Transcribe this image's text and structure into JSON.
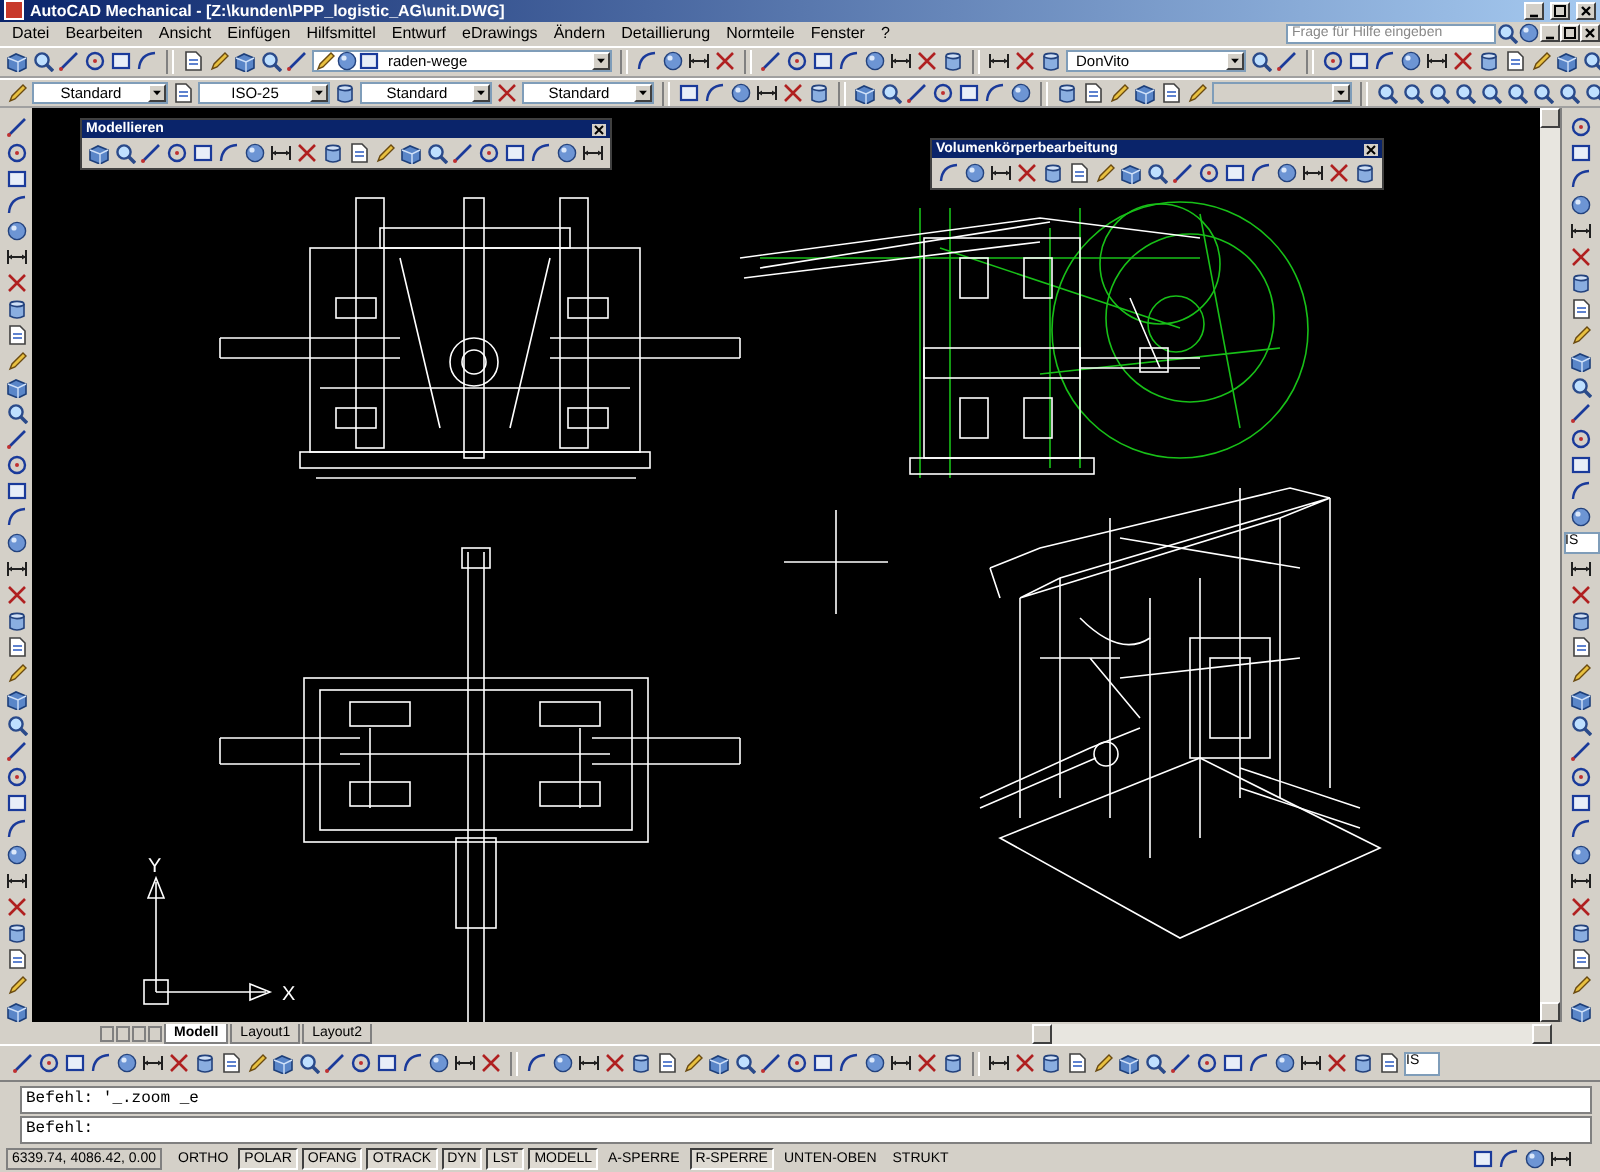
{
  "window": {
    "title": "AutoCAD Mechanical - [Z:\\kunden\\PPP_logistic_AG\\unit.DWG]"
  },
  "menu": [
    "Datei",
    "Bearbeiten",
    "Ansicht",
    "Einfügen",
    "Hilfsmittel",
    "Entwurf",
    "eDrawings",
    "Ändern",
    "Detaillierung",
    "Normteile",
    "Fenster",
    "?"
  ],
  "help_search": {
    "placeholder": "Frage für Hilfe eingeben"
  },
  "toolbar": {
    "layer": "raden-wege",
    "profile": "DonVito"
  },
  "style_boxes": [
    "Standard",
    "ISO-25",
    "Standard",
    "Standard"
  ],
  "palettes": [
    {
      "title": "Modellieren"
    },
    {
      "title": "Volumenkörperbearbeitung"
    }
  ],
  "side_field": "IS",
  "ucs": {
    "x_label": "X",
    "y_label": "Y"
  },
  "layout_tabs": [
    {
      "label": "Modell",
      "selected": true
    },
    {
      "label": "Layout1",
      "selected": false
    },
    {
      "label": "Layout2",
      "selected": false
    }
  ],
  "dim_field": "IS",
  "command_lines": [
    "Befehl: '_.zoom _e",
    "Befehl:"
  ],
  "status_bar": {
    "coordinates": "6339.74, 4086.42, 0.00",
    "toggles": [
      {
        "label": "ORTHO",
        "on": false
      },
      {
        "label": "POLAR",
        "on": true
      },
      {
        "label": "OFANG",
        "on": true
      },
      {
        "label": "OTRACK",
        "on": true
      },
      {
        "label": "DYN",
        "on": true
      },
      {
        "label": "LST",
        "on": true
      },
      {
        "label": "MODELL",
        "on": true
      },
      {
        "label": "A-SPERRE",
        "on": false
      },
      {
        "label": "R-SPERRE",
        "on": true
      },
      {
        "label": "UNTEN-OBEN",
        "on": false
      },
      {
        "label": "STRUKT",
        "on": false
      }
    ]
  }
}
